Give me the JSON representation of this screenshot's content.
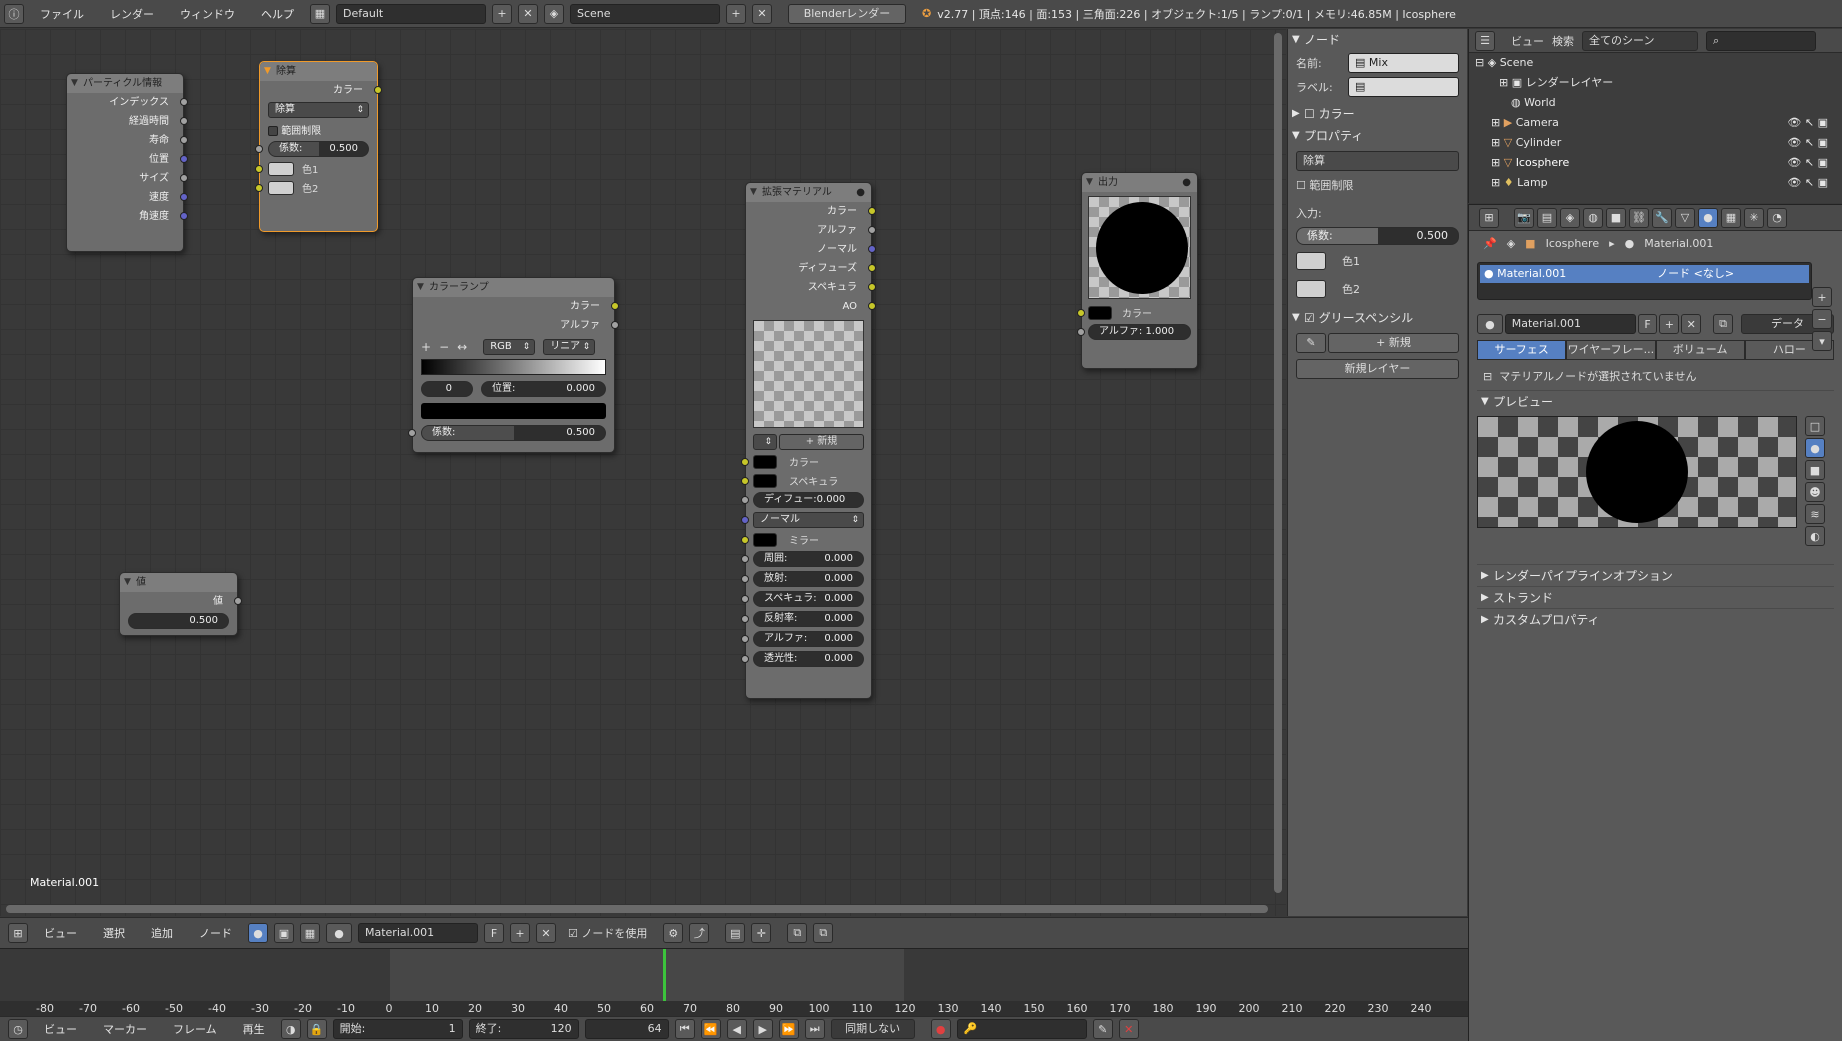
{
  "topbar": {
    "menus": [
      "ファイル",
      "レンダー",
      "ウィンドウ",
      "ヘルプ"
    ],
    "layout": "Default",
    "scene": "Scene",
    "engine": "Blenderレンダー",
    "stats": "v2.77 | 頂点:146 | 面:153 | 三角面:226 | オブジェクト:1/5 | ランプ:0/1 | メモリ:46.85M | Icosphere"
  },
  "nodes": {
    "particle": {
      "title": "パーティクル情報",
      "outputs": [
        "インデックス",
        "経過時間",
        "寿命",
        "位置",
        "サイズ",
        "速度",
        "角速度"
      ]
    },
    "divide": {
      "title": "除算",
      "out": "カラー",
      "op": "除算",
      "clamp": "範囲制限",
      "fac_label": "係数:",
      "fac_val": "0.500",
      "c1": "色1",
      "c2": "色2"
    },
    "ramp": {
      "title": "カラーランプ",
      "out1": "カラー",
      "out2": "アルファ",
      "mode": "RGB",
      "interp": "リニア",
      "index": "0",
      "pos_label": "位置:",
      "pos_val": "0.000",
      "fac_label": "係数:",
      "fac_val": "0.500"
    },
    "value": {
      "title": "値",
      "out": "値",
      "val": "0.500"
    },
    "ext": {
      "title": "拡張マテリアル",
      "outputs": [
        "カラー",
        "アルファ",
        "ノーマル",
        "ディフューズ",
        "スペキュラ",
        "AO"
      ],
      "new_label": "新規",
      "color": "カラー",
      "spec": "スペキュラ",
      "diffuse": "ディフュー:0.000",
      "normal": "ノーマル",
      "mirror": "ミラー",
      "fields": [
        {
          "l": "周囲:",
          "v": "0.000"
        },
        {
          "l": "放射:",
          "v": "0.000"
        },
        {
          "l": "スペキュラ:",
          "v": "0.000"
        },
        {
          "l": "反射率:",
          "v": "0.000"
        },
        {
          "l": "アルファ:",
          "v": "0.000"
        },
        {
          "l": "透光性:",
          "v": "0.000"
        }
      ]
    },
    "output": {
      "title": "出力",
      "color": "カラー",
      "alpha": "アルファ: 1.000"
    }
  },
  "editor_label": "Material.001",
  "npanel": {
    "node_hdr": "ノード",
    "name_label": "名前:",
    "name_val": "Mix",
    "label_label": "ラベル:",
    "color_hdr": "カラー",
    "props_hdr": "プロパティ",
    "op": "除算",
    "clamp": "範囲制限",
    "input_label": "入力:",
    "fac_label": "係数:",
    "fac_val": "0.500",
    "c1": "色1",
    "c2": "色2",
    "gp_hdr": "グリースペンシル",
    "gp_new": "新規",
    "gp_newlayer": "新規レイヤー"
  },
  "outliner": {
    "menus": [
      "ビュー",
      "検索"
    ],
    "filter": "全てのシーン",
    "rows": [
      "Scene",
      "レンダーレイヤー",
      "World",
      "Camera",
      "Cylinder",
      "Icosphere",
      "Lamp"
    ]
  },
  "props": {
    "crumb1": "Icosphere",
    "crumb2": "Material.001",
    "slot_name": "Material.001",
    "slot_node": "ノード <なし>",
    "mat_name": "Material.001",
    "mat_f": "F",
    "data_dd": "データ",
    "tabs": [
      "サーフェス",
      "ワイヤーフレー...",
      "ボリューム",
      "ハロー"
    ],
    "no_node": "マテリアルノードが選択されていません",
    "preview_hdr": "プレビュー",
    "sections": [
      "レンダーパイプラインオプション",
      "ストランド",
      "カスタムプロパティ"
    ]
  },
  "nodebar": {
    "menus": [
      "ビュー",
      "選択",
      "追加",
      "ノード"
    ],
    "material": "Material.001",
    "f": "F",
    "use_nodes": "ノードを使用"
  },
  "timeline": {
    "ticks": [
      "-80",
      "-70",
      "-60",
      "-50",
      "-40",
      "-30",
      "-20",
      "-10",
      "0",
      "10",
      "20",
      "30",
      "40",
      "50",
      "60",
      "70",
      "80",
      "90",
      "100",
      "110",
      "120",
      "130",
      "140",
      "150",
      "160",
      "170",
      "180",
      "190",
      "200",
      "210",
      "220",
      "230",
      "240"
    ],
    "current_frame": 64
  },
  "tlbar": {
    "menus": [
      "ビュー",
      "マーカー",
      "フレーム",
      "再生"
    ],
    "start_label": "開始:",
    "start": "1",
    "end_label": "終了:",
    "end": "120",
    "frame": "64",
    "sync": "同期しない"
  },
  "colors": {
    "accent": "#5680c2",
    "selected_node": "#f09a2a",
    "socket_yellow": "#c7c729",
    "socket_blue": "#6363c7",
    "playhead": "#3cc43c"
  }
}
